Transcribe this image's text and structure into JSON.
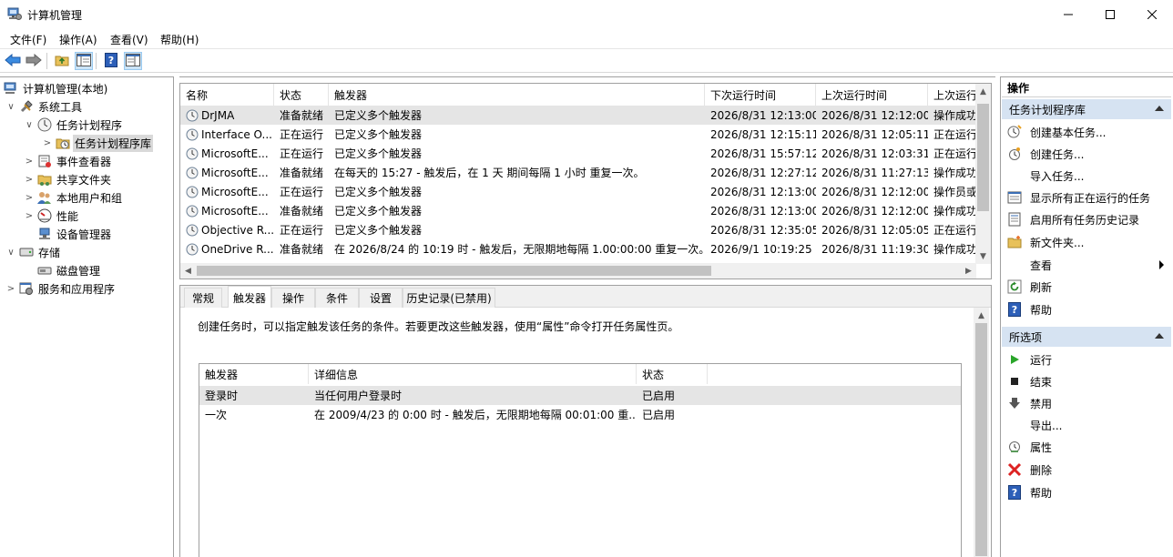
{
  "window": {
    "title": "计算机管理"
  },
  "menu": [
    "文件(F)",
    "操作(A)",
    "查看(V)",
    "帮助(H)"
  ],
  "tree": [
    {
      "label": "计算机管理(本地)",
      "arrow": ""
    },
    {
      "label": "系统工具",
      "arrow": "∨"
    },
    {
      "label": "任务计划程序",
      "arrow": "∨"
    },
    {
      "label": "任务计划程序库",
      "arrow": ">"
    },
    {
      "label": "事件查看器",
      "arrow": ">"
    },
    {
      "label": "共享文件夹",
      "arrow": ">"
    },
    {
      "label": "本地用户和组",
      "arrow": ">"
    },
    {
      "label": "性能",
      "arrow": ">"
    },
    {
      "label": "设备管理器",
      "arrow": ""
    },
    {
      "label": "存储",
      "arrow": "∨"
    },
    {
      "label": "磁盘管理",
      "arrow": ""
    },
    {
      "label": "服务和应用程序",
      "arrow": ">"
    }
  ],
  "tasks": {
    "columns": [
      "名称",
      "状态",
      "触发器",
      "下次运行时间",
      "上次运行时间",
      "上次运行"
    ],
    "rows": [
      [
        "DrJMA",
        "准备就绪",
        "已定义多个触发器",
        "2026/8/31 12:13:00",
        "2026/8/31 12:12:00",
        "操作成功"
      ],
      [
        "Interface O...",
        "正在运行",
        "已定义多个触发器",
        "2026/8/31 12:15:11",
        "2026/8/31 12:05:11",
        "正在运行"
      ],
      [
        "MicrosoftE...",
        "正在运行",
        "已定义多个触发器",
        "2026/8/31 15:57:12",
        "2026/8/31 12:03:31",
        "正在运行"
      ],
      [
        "MicrosoftE...",
        "准备就绪",
        "在每天的 15:27 - 触发后，在 1 天 期间每隔 1 小时 重复一次。",
        "2026/8/31 12:27:12",
        "2026/8/31 11:27:13",
        "操作成功"
      ],
      [
        "MicrosoftE...",
        "正在运行",
        "已定义多个触发器",
        "2026/8/31 12:13:00",
        "2026/8/31 12:12:00",
        "操作员或"
      ],
      [
        "MicrosoftE...",
        "准备就绪",
        "已定义多个触发器",
        "2026/8/31 12:13:00",
        "2026/8/31 12:12:00",
        "操作成功"
      ],
      [
        "Objective R...",
        "正在运行",
        "已定义多个触发器",
        "2026/8/31 12:35:05",
        "2026/8/31 12:05:05",
        "正在运行"
      ],
      [
        "OneDrive R...",
        "准备就绪",
        "在 2026/8/24 的 10:19 时 - 触发后，无限期地每隔 1.00:00:00 重复一次。",
        "2026/9/1 10:19:25",
        "2026/8/31 11:19:30",
        "操作成功"
      ]
    ]
  },
  "detail_tabs": [
    "常规",
    "触发器",
    "操作",
    "条件",
    "设置",
    "历史记录(已禁用)"
  ],
  "detail": {
    "description": "创建任务时，可以指定触发该任务的条件。若要更改这些触发器，使用“属性”命令打开任务属性页。",
    "trigger_columns": [
      "触发器",
      "详细信息",
      "状态"
    ],
    "trigger_rows": [
      [
        "登录时",
        "当任何用户登录时",
        "已启用"
      ],
      [
        "一次",
        "在 2009/4/23 的 0:00 时 - 触发后，无限期地每隔 00:01:00 重...",
        "已启用"
      ]
    ]
  },
  "actions": {
    "title": "操作",
    "section1": "任务计划程序库",
    "items1": [
      "创建基本任务...",
      "创建任务...",
      "导入任务...",
      "显示所有正在运行的任务",
      "启用所有任务历史记录",
      "新文件夹...",
      "查看",
      "刷新",
      "帮助"
    ],
    "section2": "所选项",
    "items2": [
      "运行",
      "结束",
      "禁用",
      "导出...",
      "属性",
      "删除",
      "帮助"
    ]
  },
  "colors": {
    "selection": "#e5e5e5",
    "section_bg": "#d6e3f2",
    "accent": "#1e6fc8"
  }
}
